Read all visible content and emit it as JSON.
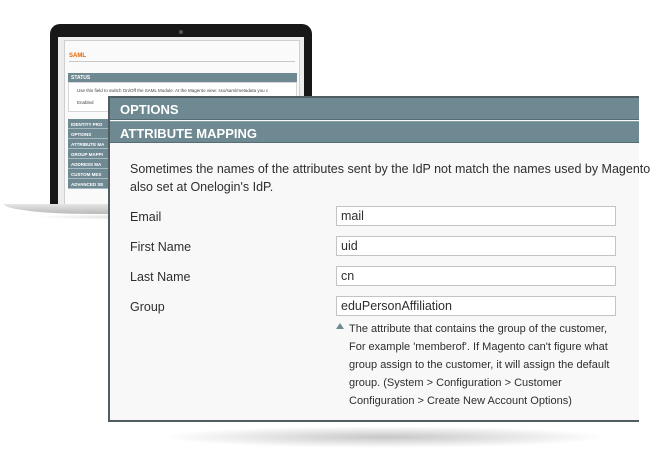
{
  "background_screen": {
    "title": "SAML",
    "status_header": "STATUS",
    "status_text": "Use this field to switch On/Off the SAML Module. At the Magento view: sso/saml/metadata you c",
    "status_value": "Enabled",
    "sections": [
      "IDENTITY PRO",
      "OPTIONS",
      "ATTRIBUTE MA",
      "GROUP MAPPI",
      "ADDRESS MA",
      "CUSTOM MES",
      "ADVANCED SE"
    ]
  },
  "panel": {
    "options_header": "OPTIONS",
    "mapping_header": "ATTRIBUTE MAPPING",
    "description_line1": "Sometimes the names of the attributes sent by the IdP not match the names used by Magento",
    "description_line2": "also set at Onelogin's IdP.",
    "fields": {
      "email": {
        "label": "Email",
        "value": "mail"
      },
      "first_name": {
        "label": "First Name",
        "value": "uid"
      },
      "last_name": {
        "label": "Last Name",
        "value": "cn"
      },
      "group": {
        "label": "Group",
        "value": "eduPersonAffiliation"
      }
    },
    "group_hint": [
      "The attribute that contains the group of the customer,",
      "For example 'memberof'. If Magento can't figure what",
      "group assign to the customer, it will assign the default",
      "group. (System > Configuration > Customer",
      "Configuration > Create New Account Options)"
    ]
  },
  "colors": {
    "header_bg": "#6f8992",
    "panel_border": "#525d61",
    "title_accent": "#e26703"
  },
  "icons": {
    "hint": "triangle-up-icon"
  }
}
